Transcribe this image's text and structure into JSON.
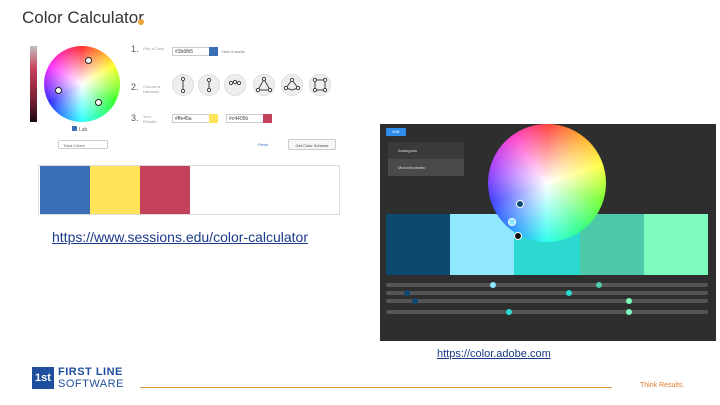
{
  "left": {
    "title": "Color Calculator",
    "pick_label": "Lab",
    "scheme_select": "Triad Colors",
    "steps": [
      {
        "num": "1.",
        "caption": "Pick a Color",
        "hex": "#3b6fb5",
        "swatch": "#3b6fb5"
      },
      {
        "num": "2.",
        "caption": "Choose a Harmony"
      },
      {
        "num": "3.",
        "caption": "Your Results",
        "hexes": [
          "#ffe45a",
          "#c4405b"
        ]
      }
    ],
    "help": "How it works",
    "reset": "Reset",
    "share": "Get Color Scheme",
    "palette": [
      "#3b6fb5",
      "#ffe45a",
      "#c4405b",
      "#ffffff"
    ],
    "url": "https://www.sessions.edu/color-calculator"
  },
  "right": {
    "button": "Edit",
    "menu": [
      "Analogous",
      "Monochromatic"
    ],
    "strip": [
      "#0b4a6e",
      "#8fe8fb",
      "#2cd9d0",
      "#4cc9a9",
      "#7efbbf"
    ],
    "url": "https://color.adobe.com"
  },
  "footer": {
    "logo_mark": "1st",
    "logo_line1": "FIRST LINE",
    "logo_line2": "SOFTWARE",
    "tagline": "Think Results."
  },
  "colors": {
    "accent": "#e39a3b",
    "brand": "#1f4e9e"
  }
}
